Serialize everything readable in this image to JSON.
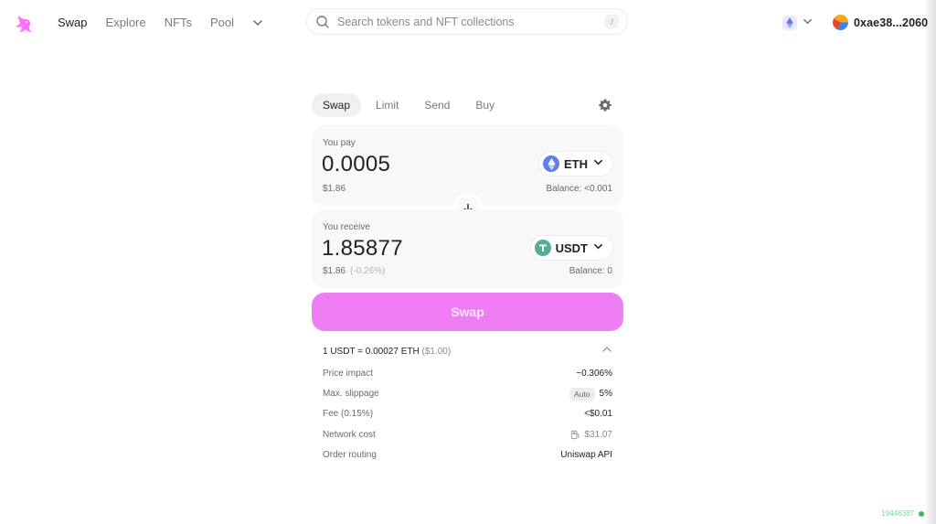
{
  "nav": {
    "items": [
      {
        "label": "Swap",
        "active": true
      },
      {
        "label": "Explore",
        "active": false
      },
      {
        "label": "NFTs",
        "active": false
      },
      {
        "label": "Pool",
        "active": false
      }
    ]
  },
  "search": {
    "placeholder": "Search tokens and NFT collections",
    "shortcut": "/"
  },
  "network": {
    "icon": "ethereum-icon"
  },
  "account": {
    "address": "0xae38...2060"
  },
  "tabs": [
    {
      "label": "Swap",
      "active": true
    },
    {
      "label": "Limit",
      "active": false
    },
    {
      "label": "Send",
      "active": false
    },
    {
      "label": "Buy",
      "active": false
    }
  ],
  "pay": {
    "label": "You pay",
    "amount": "0.0005",
    "token": "ETH",
    "usd": "$1.86",
    "balance": "Balance: <0.001"
  },
  "receive": {
    "label": "You receive",
    "amount": "1.85877",
    "token": "USDT",
    "usd": "$1.86",
    "usd_change": "(-0.26%)",
    "balance": "Balance: 0"
  },
  "swap_button": "Swap",
  "rate": {
    "text": "1 USDT = 0.00027 ETH",
    "usd": "($1.00)"
  },
  "details": {
    "price_impact_label": "Price impact",
    "price_impact_value": "~0.306%",
    "slippage_label": "Max. slippage",
    "slippage_badge": "Auto",
    "slippage_value": "5%",
    "fee_label": "Fee (0.15%)",
    "fee_value": "<$0.01",
    "network_cost_label": "Network cost",
    "network_cost_value": "$31.07",
    "routing_label": "Order routing",
    "routing_value": "Uniswap API"
  },
  "build": {
    "id": "19446387"
  },
  "colors": {
    "accent": "#ef7ef4",
    "eth": "#627eea",
    "usdt": "#50af95",
    "status": "#3fb860"
  }
}
